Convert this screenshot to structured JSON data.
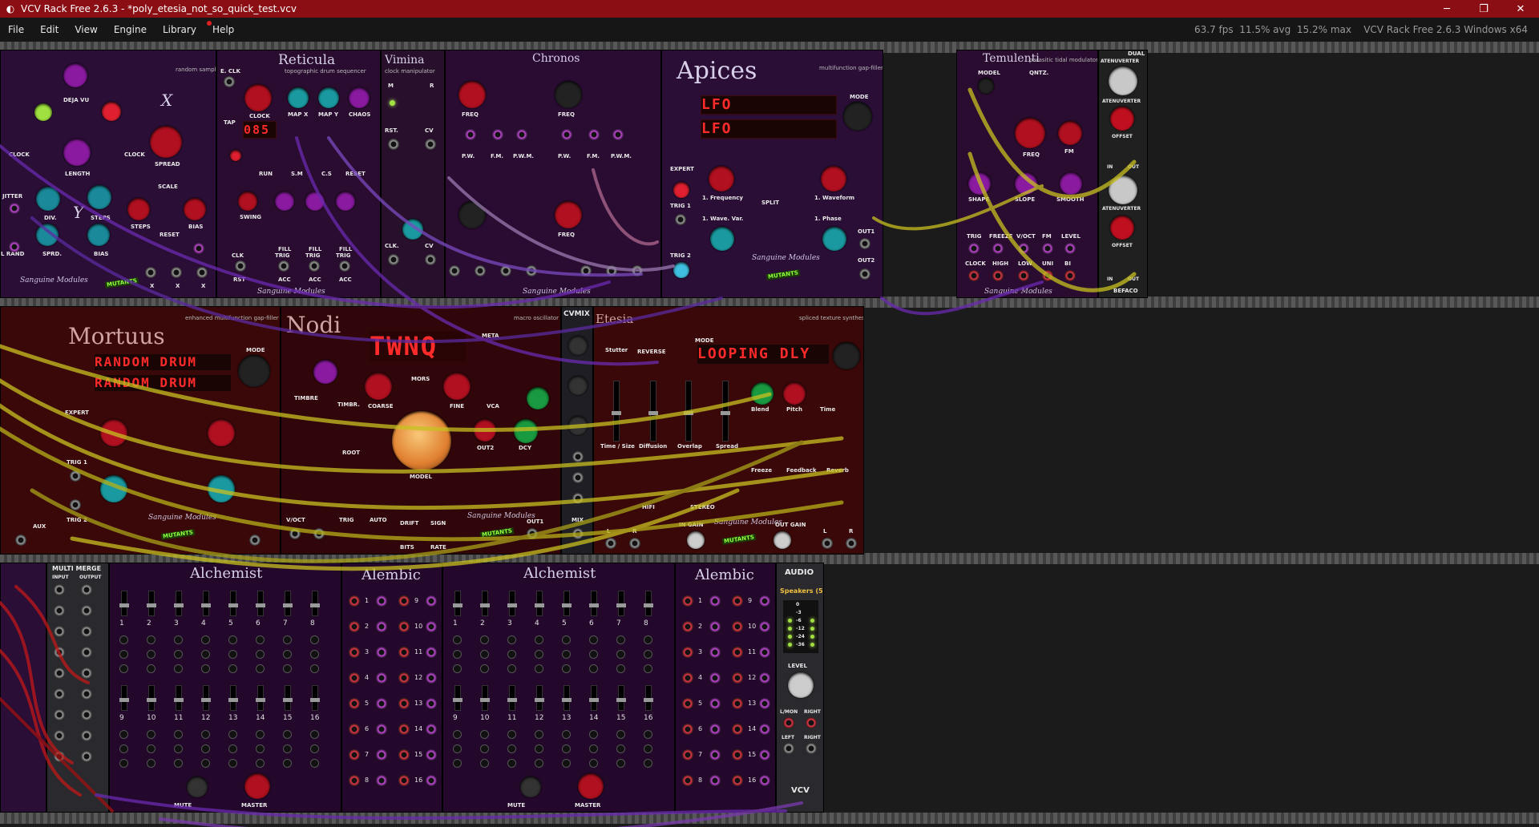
{
  "window": {
    "title": "VCV Rack Free 2.6.3 - *poly_etesia_not_so_quick_test.vcv",
    "app_icon": "vcv-logo-icon",
    "controls": [
      "─",
      "❐",
      "✕"
    ]
  },
  "menu": {
    "items": [
      "File",
      "Edit",
      "View",
      "Engine",
      "Library",
      "Help"
    ],
    "help_has_notification": true,
    "stats": "63.7 fps  11.5% avg  15.2% max    VCV Rack Free 2.6.3 Windows x64"
  },
  "modules": {
    "sampler": {
      "subtitle": "random sampler",
      "labels": [
        "DEJA VU",
        "LENGTH",
        "CLOCK",
        "DIV.",
        "STEPS",
        "JITTER",
        "SPRD.",
        "BIAS",
        "L RAND",
        "CLOCK",
        "SPREAD",
        "SCALE",
        "STEPS",
        "RESET",
        "BIAS",
        "X",
        "Y"
      ],
      "jack_labels": [
        "X",
        "X",
        "X"
      ]
    },
    "reticula": {
      "title": "Reticula",
      "subtitle": "topographic drum sequencer",
      "display": "085",
      "labels": [
        "E. CLK",
        "TAP",
        "CLOCK",
        "MAP X",
        "MAP Y",
        "CHAOS",
        "RUN",
        "S.M",
        "C.S",
        "RESET",
        "SWING",
        "FILL",
        "FILL",
        "FILL",
        "CLK",
        "TRIG",
        "TRIG",
        "TRIG",
        "RST",
        "ACC",
        "ACC",
        "ACC"
      ]
    },
    "vimina": {
      "title": "Vimina",
      "subtitle": "clock manipulator",
      "labels": [
        "M",
        "R",
        "RST.",
        "CV",
        "CLK.",
        "CV",
        "A",
        "B",
        "A",
        "B"
      ]
    },
    "chronos": {
      "title": "Chronos",
      "labels": [
        "FREQ",
        "FREQ",
        "FREQ",
        "FREQ",
        "P.W.",
        "F.M.",
        "P.W.M.",
        "P.W.",
        "F.M.",
        "P.W.M."
      ]
    },
    "apices": {
      "title": "Apices",
      "subtitle": "multifunction gap-filler",
      "display_lines": [
        "LFO",
        "LFO"
      ],
      "labels": [
        "MODE",
        "EXPERT",
        "TRIG 1",
        "TRIG 2",
        "SPLIT",
        "OUT1",
        "OUT2",
        "1. Frequency",
        "1. Waveform",
        "1. Wave. Var.",
        "1. Phase"
      ]
    },
    "temulenti": {
      "title": "Temulenti",
      "subtitle": "parasitic tidal modulator",
      "labels": [
        "MODEL",
        "QNTZ.",
        "FREQ",
        "FM",
        "SHAPE",
        "SLOPE",
        "SMOOTH",
        "TRIG",
        "FREEZE",
        "V/OCT",
        "FM",
        "LEVEL",
        "CLOCK",
        "HIGH",
        "LOW",
        "UNI",
        "BI"
      ]
    },
    "dual_atenuverter": {
      "title": "DUAL",
      "labels": [
        "ATENUVERTER",
        "ATENUVERTER",
        "OFFSET",
        "ATENUVERTER",
        "OFFSET",
        "IN",
        "OUT",
        "IN",
        "OUT"
      ],
      "brand": "BEFACO"
    },
    "mortuus": {
      "title": "Mortuus",
      "subtitle": "enhanced multifunction gap-filler",
      "display_lines": [
        "RANDOM DRUM",
        "RANDOM DRUM"
      ],
      "labels": [
        "MODE",
        "TRIG 1",
        "TRIG 2",
        "AUX",
        "EXPERT"
      ]
    },
    "nodi": {
      "title": "Nodi",
      "subtitle": "macro oscillator",
      "display": "TWNQ",
      "labels": [
        "META",
        "MORS",
        "TIMBRE",
        "COARSE",
        "FINE",
        "TIMBR.",
        "ROOT",
        "MODEL",
        "OUT1",
        "OUT2",
        "DCY",
        "V/OCT",
        "TRIG",
        "AUTO",
        "DRIFT",
        "SIGN",
        "BITS",
        "RATE",
        "VCA",
        "DCY"
      ]
    },
    "cvmix": {
      "title": "CVMIX",
      "labels": [
        "MIX"
      ]
    },
    "etesia": {
      "title": "Etesia",
      "subtitle": "spliced texture synthesizer",
      "display": "LOOPING DLY",
      "labels": [
        "Stutter",
        "MODE",
        "REVERSE",
        "Blend",
        "Pitch",
        "Time",
        "Time / Size",
        "Diffusion",
        "Overlap",
        "Spread",
        "Freeze",
        "Feedback",
        "Reverb",
        "HIFI",
        "STEREO",
        "IN GAIN",
        "OUT GAIN",
        "L",
        "R",
        "L",
        "R"
      ]
    },
    "multi_merge": {
      "title": "MULTI MERGE",
      "labels": [
        "INPUT",
        "OUTPUT"
      ]
    },
    "alchemist_1": {
      "title": "Alchemist",
      "numbers": [
        "1",
        "2",
        "3",
        "4",
        "5",
        "6",
        "7",
        "8",
        "9",
        "10",
        "11",
        "12",
        "13",
        "14",
        "15",
        "16"
      ],
      "labels": [
        "MUTE",
        "MASTER"
      ]
    },
    "alembic_1": {
      "title": "Alembic",
      "numbers": [
        "1",
        "2",
        "3",
        "4",
        "5",
        "6",
        "7",
        "8",
        "9",
        "10",
        "11",
        "12",
        "13",
        "14",
        "15",
        "16"
      ]
    },
    "alchemist_2": {
      "title": "Alchemist",
      "numbers": [
        "1",
        "2",
        "3",
        "4",
        "5",
        "6",
        "7",
        "8",
        "9",
        "10",
        "11",
        "12",
        "13",
        "14",
        "15",
        "16"
      ],
      "labels": [
        "MUTE",
        "MASTER"
      ]
    },
    "alembic_2": {
      "title": "Alembic",
      "numbers": [
        "1",
        "2",
        "3",
        "4",
        "5",
        "6",
        "7",
        "8",
        "9",
        "10",
        "11",
        "12",
        "13",
        "14",
        "15",
        "16"
      ]
    },
    "audio": {
      "title": "AUDIO",
      "device": "Speakers (5",
      "meter_labels": [
        "0",
        "-3",
        "-6",
        "-12",
        "-24",
        "-36"
      ],
      "labels": [
        "LEVEL",
        "L/MON",
        "RIGHT",
        "LEFT",
        "RIGHT"
      ],
      "brand": "VCV"
    },
    "branding": {
      "sanguine": "Sanguine Modules",
      "mutants": "MUTANTS"
    }
  },
  "colors": {
    "titlebar": "#8b0e14",
    "menubar": "#161616",
    "rack": "#1b1b1b",
    "panel_purple": "#2a0a38",
    "panel_red": "#3a0808",
    "cable_yellow": "#c8c020",
    "cable_purple": "#6a2ab0",
    "cable_red": "#c01818",
    "display_red": "#ff2a2a"
  }
}
